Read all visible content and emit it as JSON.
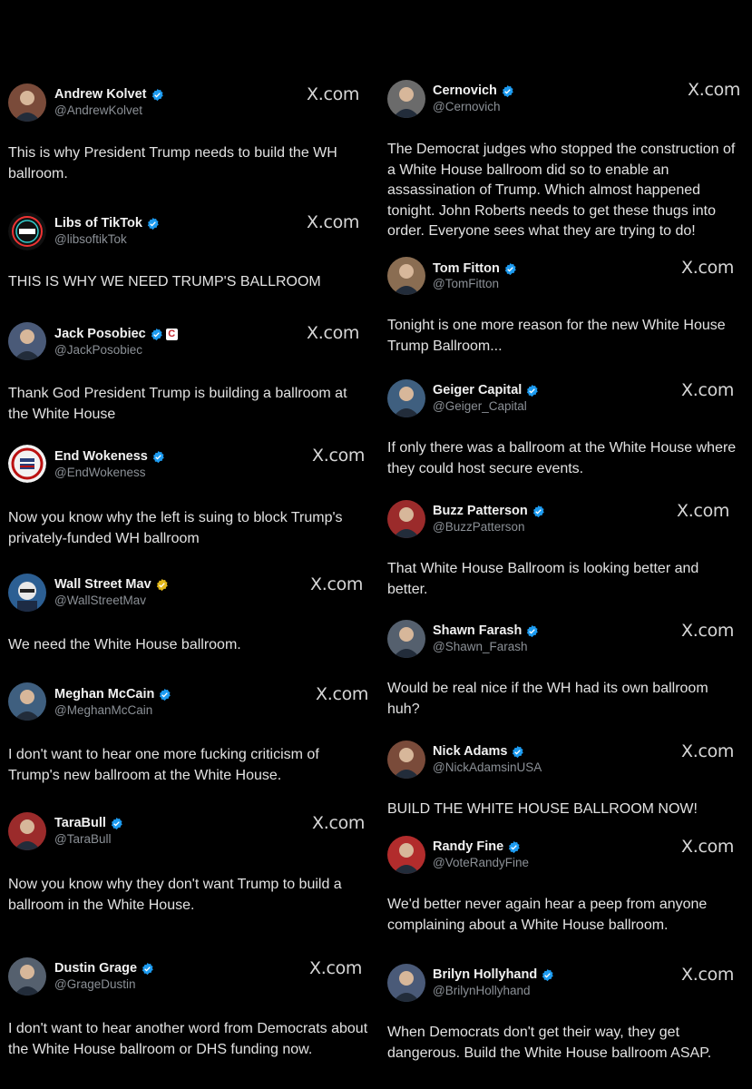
{
  "site_label": "X.com",
  "colors": {
    "background": "#000000",
    "verified_blue": "#1d9bf0",
    "verified_gold": "#e2b719"
  },
  "left_posts": [
    {
      "name": "Andrew Kolvet",
      "handle": "@AndrewKolvet",
      "verified": "blue",
      "icon": "avatar-photo",
      "text": "This is why President Trump needs to build the WH ballroom."
    },
    {
      "name": "Libs of TikTok",
      "handle": "@libsoftikTok",
      "verified": "blue",
      "icon": "libs-of-tiktok-logo",
      "text": "THIS IS WHY WE NEED TRUMP'S BALLROOM"
    },
    {
      "name": "Jack Posobiec",
      "handle": "@JackPosobiec",
      "verified": "blue",
      "affiliate": "C",
      "icon": "avatar-photo",
      "text": "Thank God President Trump is building a ballroom at the White House"
    },
    {
      "name": "End Wokeness",
      "handle": "@EndWokeness",
      "verified": "blue",
      "icon": "end-wokeness-seal",
      "text": "Now you know why the left is suing to block Trump's privately-funded WH ballroom"
    },
    {
      "name": "Wall Street Mav",
      "handle": "@WallStreetMav",
      "verified": "gold",
      "icon": "cartoon-avatar",
      "text": "We need the White House ballroom."
    },
    {
      "name": "Meghan McCain",
      "handle": "@MeghanMcCain",
      "verified": "blue",
      "icon": "avatar-photo",
      "text": "I don't want to hear one more fucking criticism of Trump's new ballroom at the White House."
    },
    {
      "name": "TaraBull",
      "handle": "@TaraBull",
      "verified": "blue",
      "icon": "avatar-photo",
      "text": "Now you know why they don't want Trump to build a ballroom in the White House."
    },
    {
      "name": "Dustin Grage",
      "handle": "@GrageDustin",
      "verified": "blue",
      "icon": "avatar-photo",
      "text": "I don't want to hear another word from Democrats about the White House ballroom or DHS funding now."
    }
  ],
  "right_posts": [
    {
      "name": "Cernovich",
      "handle": "@Cernovich",
      "verified": "blue",
      "icon": "avatar-photo",
      "text": "The Democrat judges who stopped the construction of a White House ballroom did so to enable an assassination of Trump. Which almost happened tonight. John Roberts needs to get these thugs into order. Everyone sees what they are trying to do!"
    },
    {
      "name": "Tom Fitton",
      "handle": "@TomFitton",
      "verified": "blue",
      "icon": "avatar-photo",
      "text": "Tonight is one more reason for the new White House Trump Ballroom..."
    },
    {
      "name": "Geiger Capital",
      "handle": "@Geiger_Capital",
      "verified": "blue",
      "icon": "avatar-photo",
      "text": "If only there was a ballroom at the White House where they could host secure events."
    },
    {
      "name": "Buzz Patterson",
      "handle": "@BuzzPatterson",
      "verified": "blue",
      "icon": "avatar-photo",
      "text": "That White House Ballroom is looking better and better."
    },
    {
      "name": "Shawn Farash",
      "handle": "@Shawn_Farash",
      "verified": "blue",
      "icon": "avatar-photo",
      "text": "Would be real nice if the WH had its own ballroom huh?"
    },
    {
      "name": "Nick Adams",
      "handle": "@NickAdamsinUSA",
      "verified": "blue",
      "icon": "avatar-photo",
      "text": "BUILD THE WHITE HOUSE BALLROOM NOW!"
    },
    {
      "name": "Randy Fine",
      "handle": "@VoteRandyFine",
      "verified": "blue",
      "icon": "avatar-photo",
      "text": "We'd better never again hear a peep from anyone complaining about a White House ballroom."
    },
    {
      "name": "Brilyn Hollyhand",
      "handle": "@BrilynHollyhand",
      "verified": "blue",
      "icon": "avatar-photo",
      "text": "When Democrats don't get their way, they get dangerous. Build the White House ballroom ASAP."
    }
  ]
}
